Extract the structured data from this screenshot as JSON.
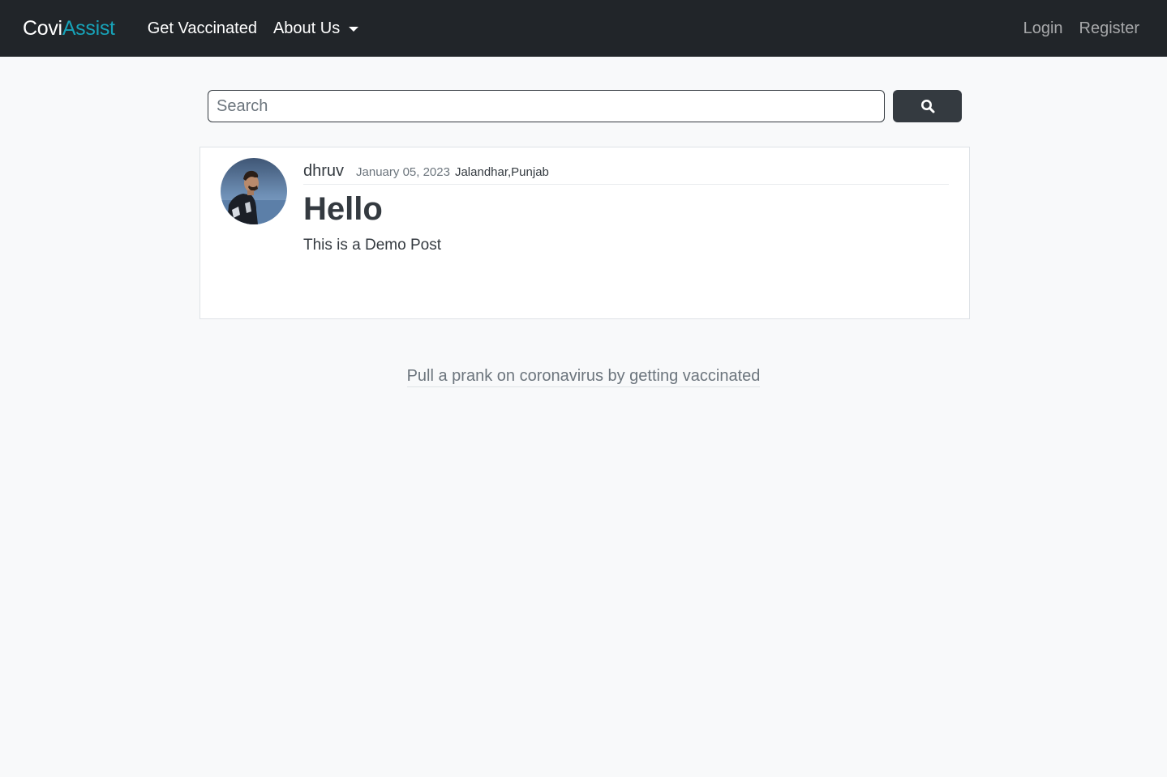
{
  "navbar": {
    "brand_part1": "Covi",
    "brand_part2": "Assist",
    "links": {
      "get_vaccinated": "Get Vaccinated",
      "about_us": "About Us",
      "login": "Login",
      "register": "Register"
    },
    "brand_accent_color": "#17a2b8"
  },
  "search": {
    "placeholder": "Search",
    "value": "",
    "button_icon": "search-icon"
  },
  "post": {
    "author": "dhruv",
    "date": "January 05, 2023",
    "location": "Jalandhar,Punjab",
    "title": "Hello",
    "body": "This is a Demo Post",
    "avatar": "avatar-photo"
  },
  "footer": {
    "tagline": "Pull a prank on coronavirus by getting vaccinated"
  }
}
